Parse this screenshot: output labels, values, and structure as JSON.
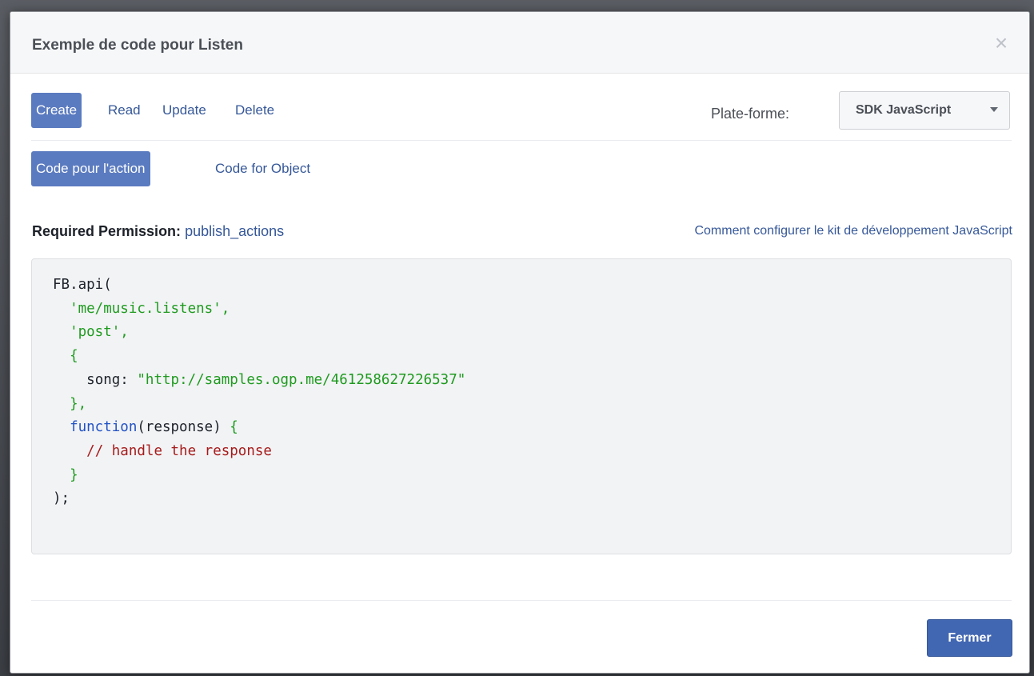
{
  "dialog": {
    "title": "Exemple de code pour Listen",
    "close_icon": "×"
  },
  "crud_tabs": [
    "Create",
    "Read",
    "Update",
    "Delete"
  ],
  "platform": {
    "label": "Plate-forme:",
    "selected": "SDK JavaScript"
  },
  "code_tabs": [
    "Code pour l'action",
    "Code for Object"
  ],
  "permission": {
    "label": "Required Permission:",
    "value": "publish_actions"
  },
  "help_link": "Comment configurer le kit de développement JavaScript",
  "code": {
    "line1": "FB.api(",
    "line2": "'me/music.listens',",
    "line3": "'post',",
    "line4": "{",
    "line5_key": "song:",
    "line5_value": "\"http://samples.ogp.me/461258627226537\"",
    "line6": "},",
    "line7_kw": "function",
    "line7_rest": "(response)",
    "line7_brace": "{",
    "line8": "// handle the response",
    "line9": "}",
    "line10": ");"
  },
  "footer": {
    "close_label": "Fermer"
  },
  "colors": {
    "accent": "#4267b2",
    "active_tab": "#5b7bc0",
    "link": "#365899",
    "code_string": "#1f9b1f",
    "code_keyword": "#2252c4",
    "code_comment": "#a61b1b"
  }
}
